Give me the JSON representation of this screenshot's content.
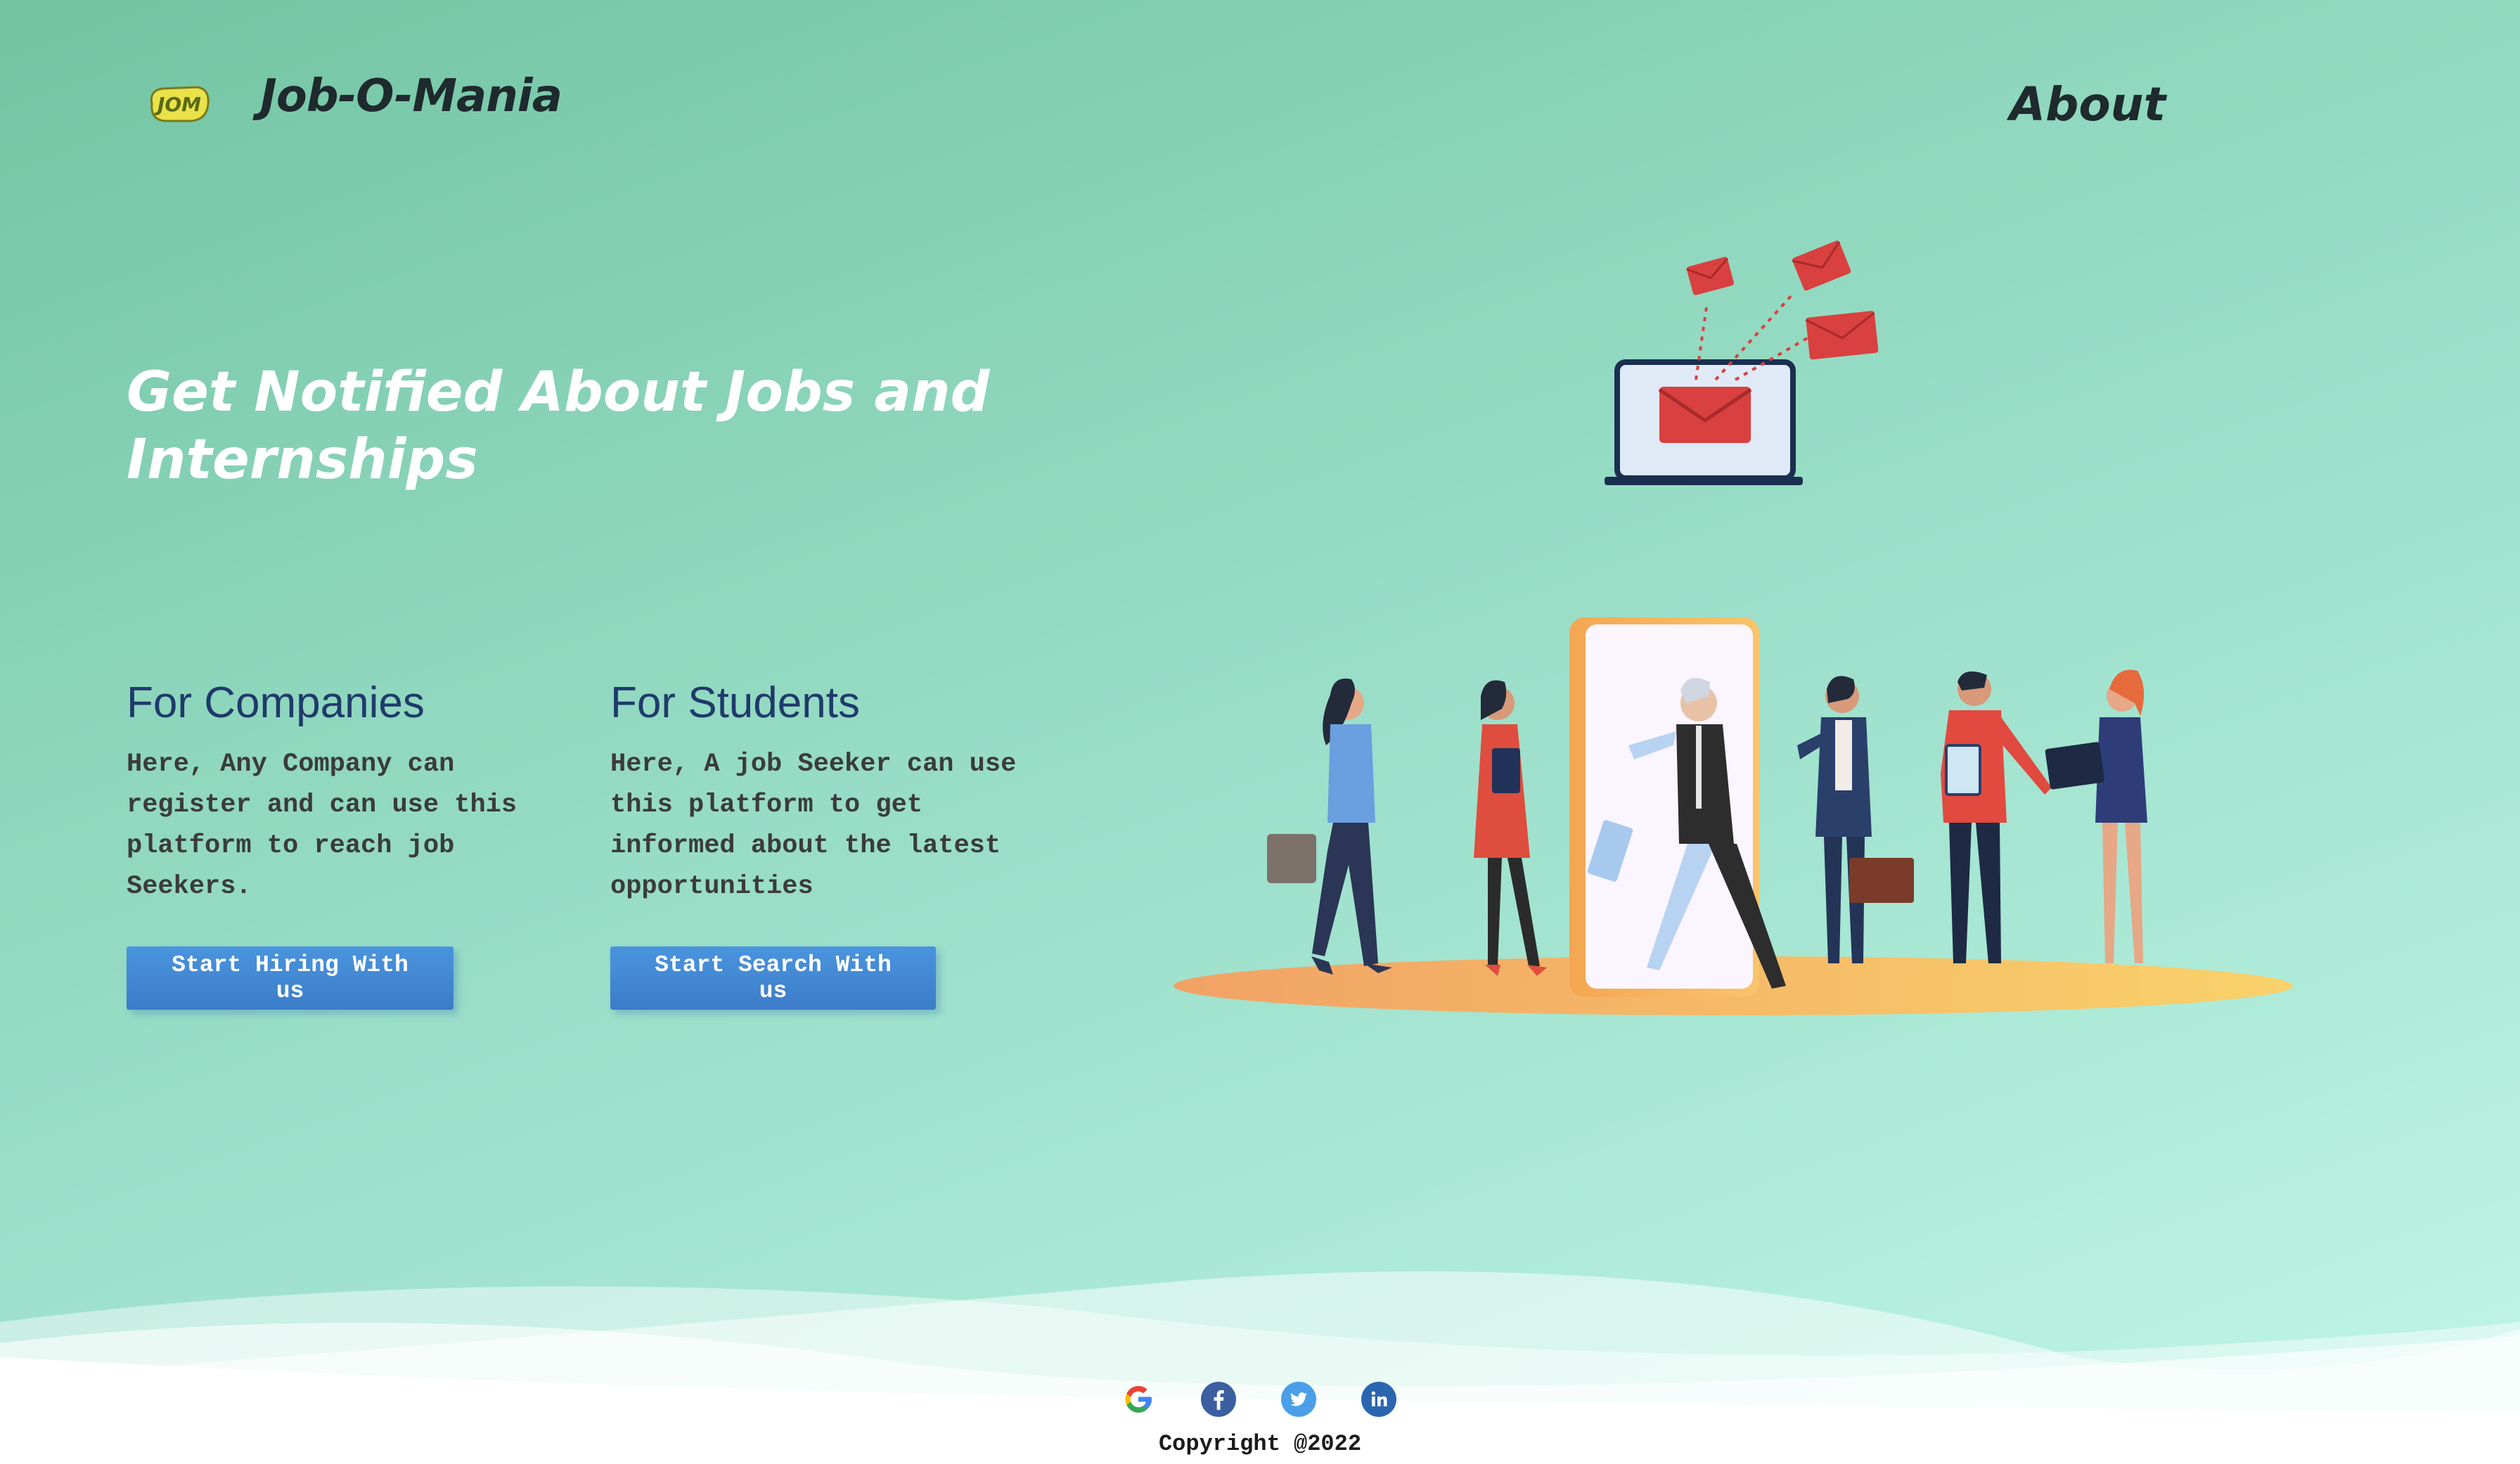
{
  "header": {
    "brand_name": "Job-O-Mania",
    "logo_text": "JOM",
    "about_label": "About"
  },
  "hero": {
    "title": "Get Notified About Jobs and Internships"
  },
  "companies": {
    "heading": "For Companies",
    "description": "Here, Any Company can register and can use this platform to reach job Seekers.",
    "button_label": "Start Hiring With us"
  },
  "students": {
    "heading": "For Students",
    "description": "Here, A job Seeker can use this platform to get informed about the latest opportunities",
    "button_label": "Start Search With us"
  },
  "footer": {
    "social_icons": [
      "google-icon",
      "facebook-icon",
      "twitter-icon",
      "linkedin-icon"
    ],
    "copyright": "Copyright @2022"
  },
  "colors": {
    "accent_blue": "#3c7cc8",
    "heading_navy": "#1f3a6b",
    "bg_green_start": "#72c4a3",
    "bg_green_end": "#c2f6e7",
    "email_red": "#d94040"
  }
}
